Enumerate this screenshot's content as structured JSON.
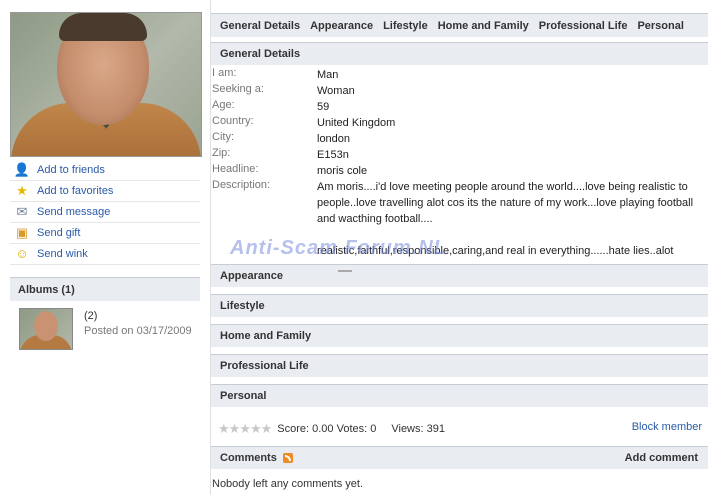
{
  "profile_actions": [
    {
      "label": "Add to friends",
      "icon": "add-friend-icon"
    },
    {
      "label": "Add to favorites",
      "icon": "star-icon"
    },
    {
      "label": "Send message",
      "icon": "envelope-icon"
    },
    {
      "label": "Send gift",
      "icon": "gift-icon"
    },
    {
      "label": "Send wink",
      "icon": "smiley-icon"
    }
  ],
  "albums": {
    "title": "Albums (1)",
    "items": [
      {
        "count": "(2)",
        "posted": "Posted on 03/17/2009"
      }
    ]
  },
  "tabs": [
    "General Details",
    "Appearance",
    "Lifestyle",
    "Home and Family",
    "Professional Life",
    "Personal"
  ],
  "general": {
    "title": "General Details",
    "fields": [
      {
        "key": "I am:",
        "value": "Man"
      },
      {
        "key": "Seeking a:",
        "value": "Woman"
      },
      {
        "key": "Age:",
        "value": "59"
      },
      {
        "key": "Country:",
        "value": "United Kingdom"
      },
      {
        "key": "City:",
        "value": "london"
      },
      {
        "key": "Zip:",
        "value": "E153n"
      },
      {
        "key": "Headline:",
        "value": "moris cole"
      },
      {
        "key": "Description:",
        "value": "Am moris....i'd love meeting people around the world....love being realistic to people..love travelling alot cos its the nature of my work...love playing football and wacthing football...."
      }
    ],
    "extra_text": "realistic,faithful,responsible,caring,and real in everything......hate lies..alot"
  },
  "watermark": "Anti-Scam Forum.NL",
  "sections": [
    "Appearance",
    "Lifestyle",
    "Home and Family",
    "Professional Life",
    "Personal"
  ],
  "rating": {
    "score_text": "Score: 0.00 Votes: 0",
    "views_text": "Views: 391",
    "stars": 5
  },
  "block_label": "Block member",
  "comments": {
    "title": "Comments",
    "add_label": "Add comment",
    "empty_text": "Nobody left any comments yet."
  }
}
